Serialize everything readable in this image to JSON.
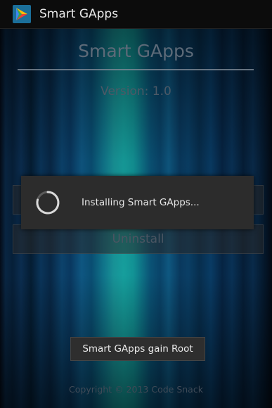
{
  "action_bar": {
    "title": "Smart GApps",
    "icon": "play-store-icon"
  },
  "main": {
    "title": "Smart GApps",
    "version": "Version: 1.0",
    "install_label": "",
    "uninstall_label": "Uninstall",
    "root_button_label": "Smart GApps gain Root",
    "copyright": "Copyright © 2013 Code Snack"
  },
  "progress_dialog": {
    "message": "Installing Smart GApps...",
    "icon": "loading-spinner-icon"
  }
}
